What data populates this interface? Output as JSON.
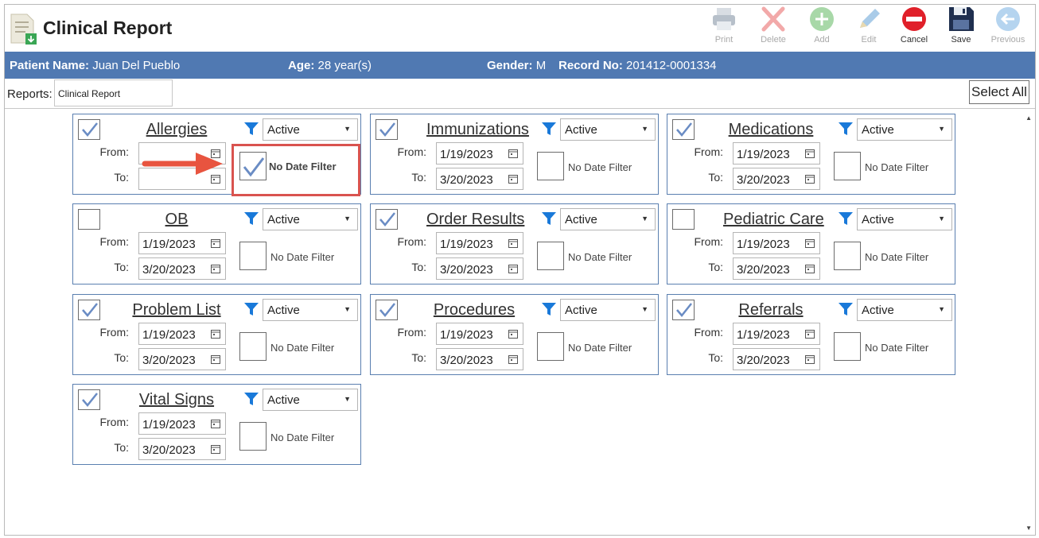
{
  "app": {
    "title": "Clinical Report"
  },
  "toolbar": {
    "print": "Print",
    "delete": "Delete",
    "add": "Add",
    "edit": "Edit",
    "cancel": "Cancel",
    "save": "Save",
    "previous": "Previous"
  },
  "patient": {
    "name_label": "Patient Name:",
    "name": "Juan Del Pueblo",
    "age_label": "Age:",
    "age": "28 year(s)",
    "gender_label": "Gender:",
    "gender": "M",
    "record_label": "Record No:",
    "record": "201412-0001334"
  },
  "reports": {
    "label": "Reports:",
    "value": "Clinical Report",
    "select_all": "Select All"
  },
  "common": {
    "from": "From:",
    "to": "To:",
    "no_date_filter": "No Date Filter"
  },
  "cards": [
    {
      "title": "Allergies",
      "checked": true,
      "status": "Active",
      "from": "",
      "to": "",
      "no_date_filter": true
    },
    {
      "title": "Immunizations",
      "checked": true,
      "status": "Active",
      "from": "1/19/2023",
      "to": "3/20/2023",
      "no_date_filter": false
    },
    {
      "title": "Medications",
      "checked": true,
      "status": "Active",
      "from": "1/19/2023",
      "to": "3/20/2023",
      "no_date_filter": false
    },
    {
      "title": "OB",
      "checked": false,
      "status": "Active",
      "from": "1/19/2023",
      "to": "3/20/2023",
      "no_date_filter": false
    },
    {
      "title": "Order Results",
      "checked": true,
      "status": "Active",
      "from": "1/19/2023",
      "to": "3/20/2023",
      "no_date_filter": false
    },
    {
      "title": "Pediatric Care",
      "checked": false,
      "status": "Active",
      "from": "1/19/2023",
      "to": "3/20/2023",
      "no_date_filter": false
    },
    {
      "title": "Problem List",
      "checked": true,
      "status": "Active",
      "from": "1/19/2023",
      "to": "3/20/2023",
      "no_date_filter": false
    },
    {
      "title": "Procedures",
      "checked": true,
      "status": "Active",
      "from": "1/19/2023",
      "to": "3/20/2023",
      "no_date_filter": false
    },
    {
      "title": "Referrals",
      "checked": true,
      "status": "Active",
      "from": "1/19/2023",
      "to": "3/20/2023",
      "no_date_filter": false
    },
    {
      "title": "Vital Signs",
      "checked": true,
      "status": "Active",
      "from": "1/19/2023",
      "to": "3/20/2023",
      "no_date_filter": false
    }
  ],
  "colors": {
    "header_bar": "#5079b2",
    "card_border": "#5a7fb0",
    "check": "#6a8cc4",
    "highlight": "#d9534f",
    "arrow": "#e8543f"
  }
}
